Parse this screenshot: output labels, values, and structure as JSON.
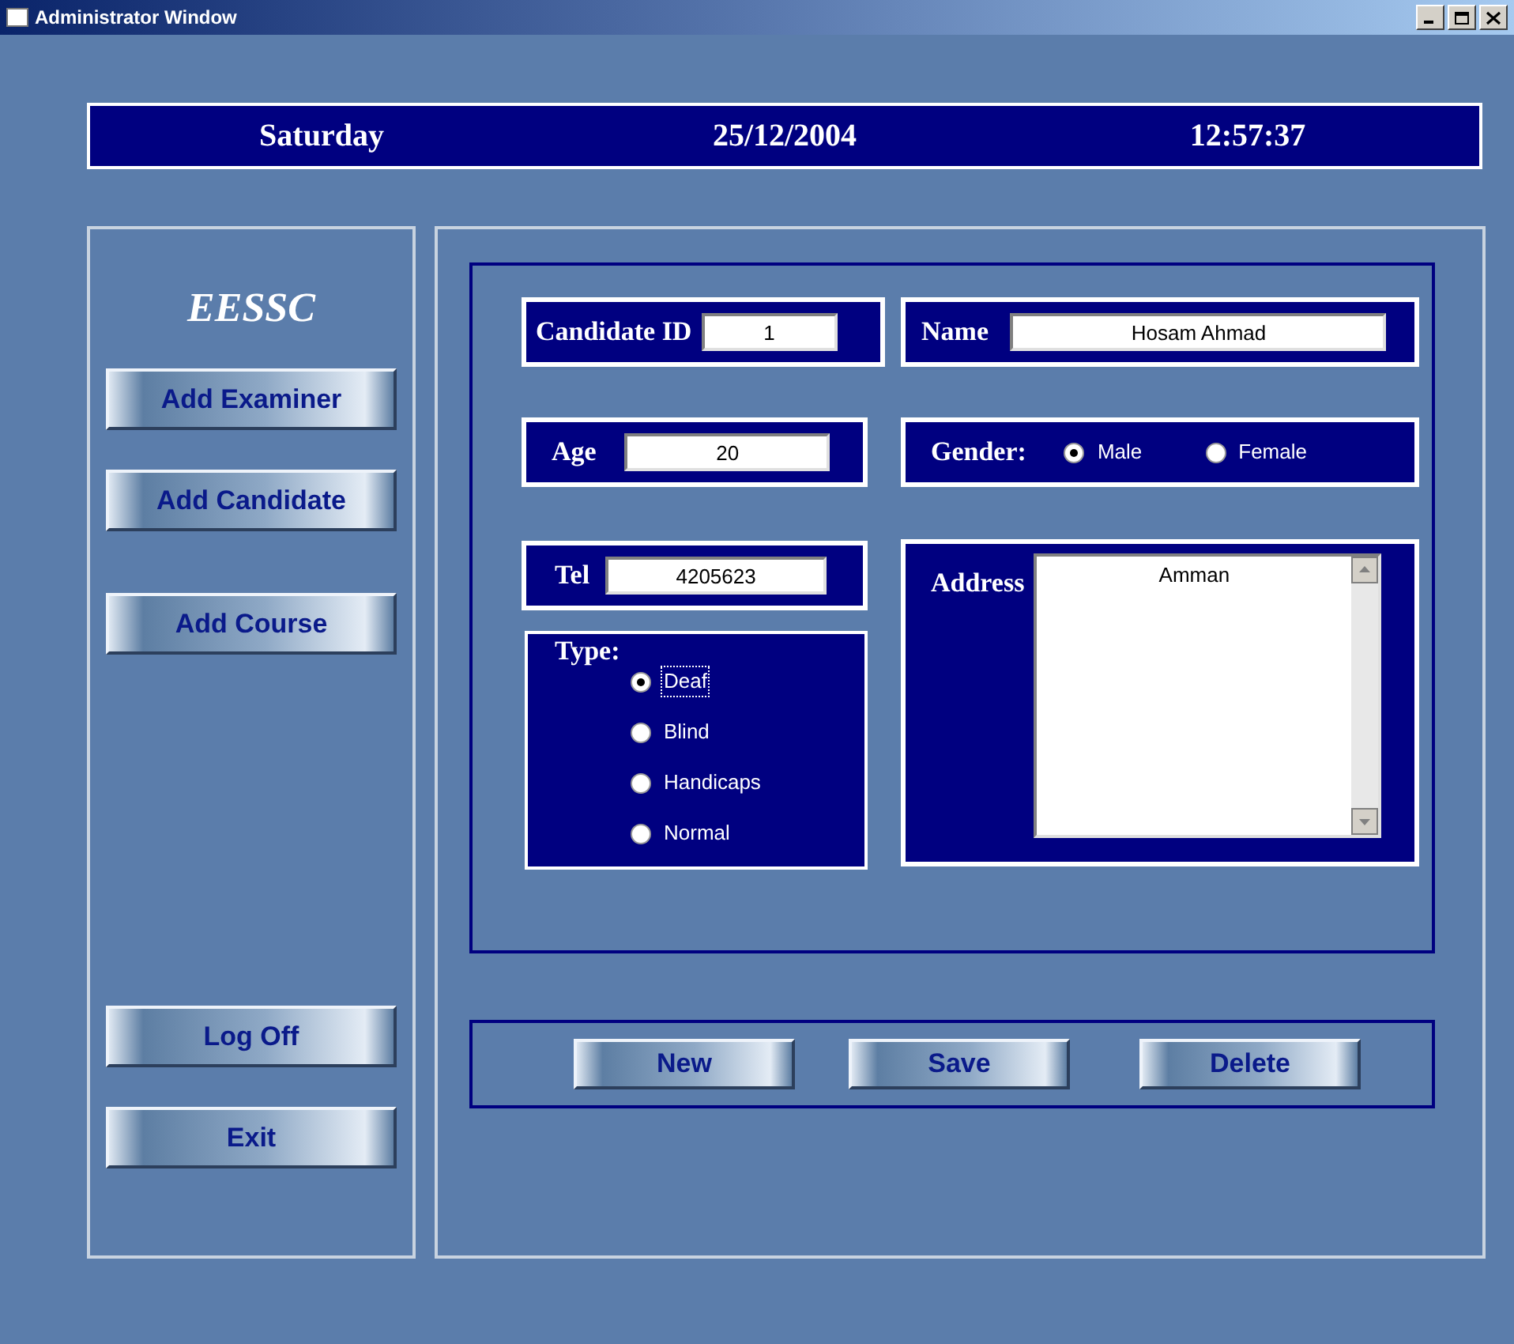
{
  "window": {
    "title": "Administrator Window"
  },
  "header": {
    "day": "Saturday",
    "date": "25/12/2004",
    "time": "12:57:37"
  },
  "sidebar": {
    "logo": "EESSC",
    "buttons": [
      "Add Examiner",
      "Add Candidate",
      "Add Course"
    ],
    "bottom_buttons": [
      "Log Off",
      "Exit"
    ]
  },
  "form": {
    "candidate_id": {
      "label": "Candidate ID",
      "value": "1"
    },
    "name": {
      "label": "Name",
      "value": "Hosam Ahmad"
    },
    "age": {
      "label": "Age",
      "value": "20"
    },
    "gender": {
      "label": "Gender:",
      "options": [
        {
          "label": "Male",
          "selected": true
        },
        {
          "label": "Female",
          "selected": false
        }
      ]
    },
    "tel": {
      "label": "Tel",
      "value": "4205623"
    },
    "address": {
      "label": "Address",
      "value": "Amman"
    },
    "type": {
      "label": "Type:",
      "options": [
        {
          "label": "Deaf",
          "selected": true,
          "focused": true
        },
        {
          "label": "Blind",
          "selected": false,
          "focused": false
        },
        {
          "label": "Handicaps",
          "selected": false,
          "focused": false
        },
        {
          "label": "Normal",
          "selected": false,
          "focused": false
        }
      ]
    }
  },
  "actions": [
    "New",
    "Save",
    "Delete"
  ]
}
